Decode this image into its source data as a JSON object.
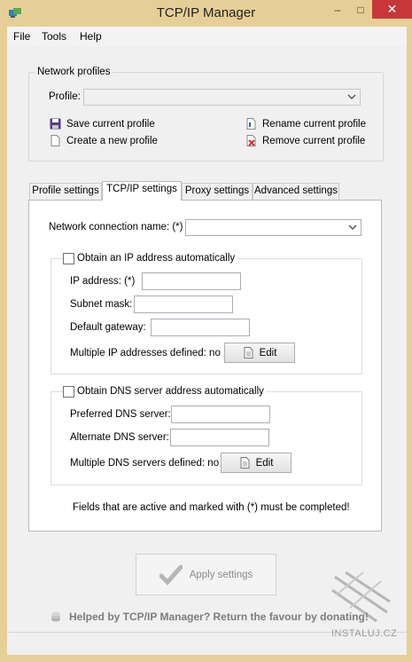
{
  "window": {
    "title": "TCP/IP Manager",
    "controls": {
      "minimize": "–",
      "maximize": "□",
      "close": "✕"
    }
  },
  "menu": {
    "file": "File",
    "tools": "Tools",
    "help": "Help"
  },
  "profiles": {
    "group_title": "Network profiles",
    "profile_label": "Profile:",
    "profile_value": "",
    "actions": {
      "save": "Save current profile",
      "create": "Create a new profile",
      "rename": "Rename current profile",
      "remove": "Remove current profile"
    }
  },
  "tabs": [
    {
      "label": "Profile settings"
    },
    {
      "label": "TCP/IP settings",
      "active": true
    },
    {
      "label": "Proxy settings"
    },
    {
      "label": "Advanced settings"
    }
  ],
  "tcpip": {
    "connection_label": "Network connection name: (*)",
    "connection_value": "",
    "ip_group": {
      "checkbox_label": "Obtain an IP address automatically",
      "checked": false,
      "ip_label": "IP address: (*)",
      "subnet_label": "Subnet mask:",
      "gateway_label": "Default gateway:",
      "multiple_label": "Multiple IP addresses defined: no",
      "edit_label": "Edit"
    },
    "dns_group": {
      "checkbox_label": "Obtain DNS server address automatically",
      "checked": false,
      "preferred_label": "Preferred DNS server:",
      "alternate_label": "Alternate DNS server:",
      "multiple_label": "Multiple DNS servers defined: no",
      "edit_label": "Edit"
    },
    "note": "Fields that are active and marked with (*) must be completed!"
  },
  "apply_label": "Apply settings",
  "donate_text": "Helped by TCP/IP Manager? Return the favour by donating!",
  "watermark": "INSTALUJ.CZ",
  "colors": {
    "frame": "#e6cf96",
    "close": "#c7373a",
    "remove_icon": "#d03030",
    "check_icon": "#b5b5b5"
  }
}
